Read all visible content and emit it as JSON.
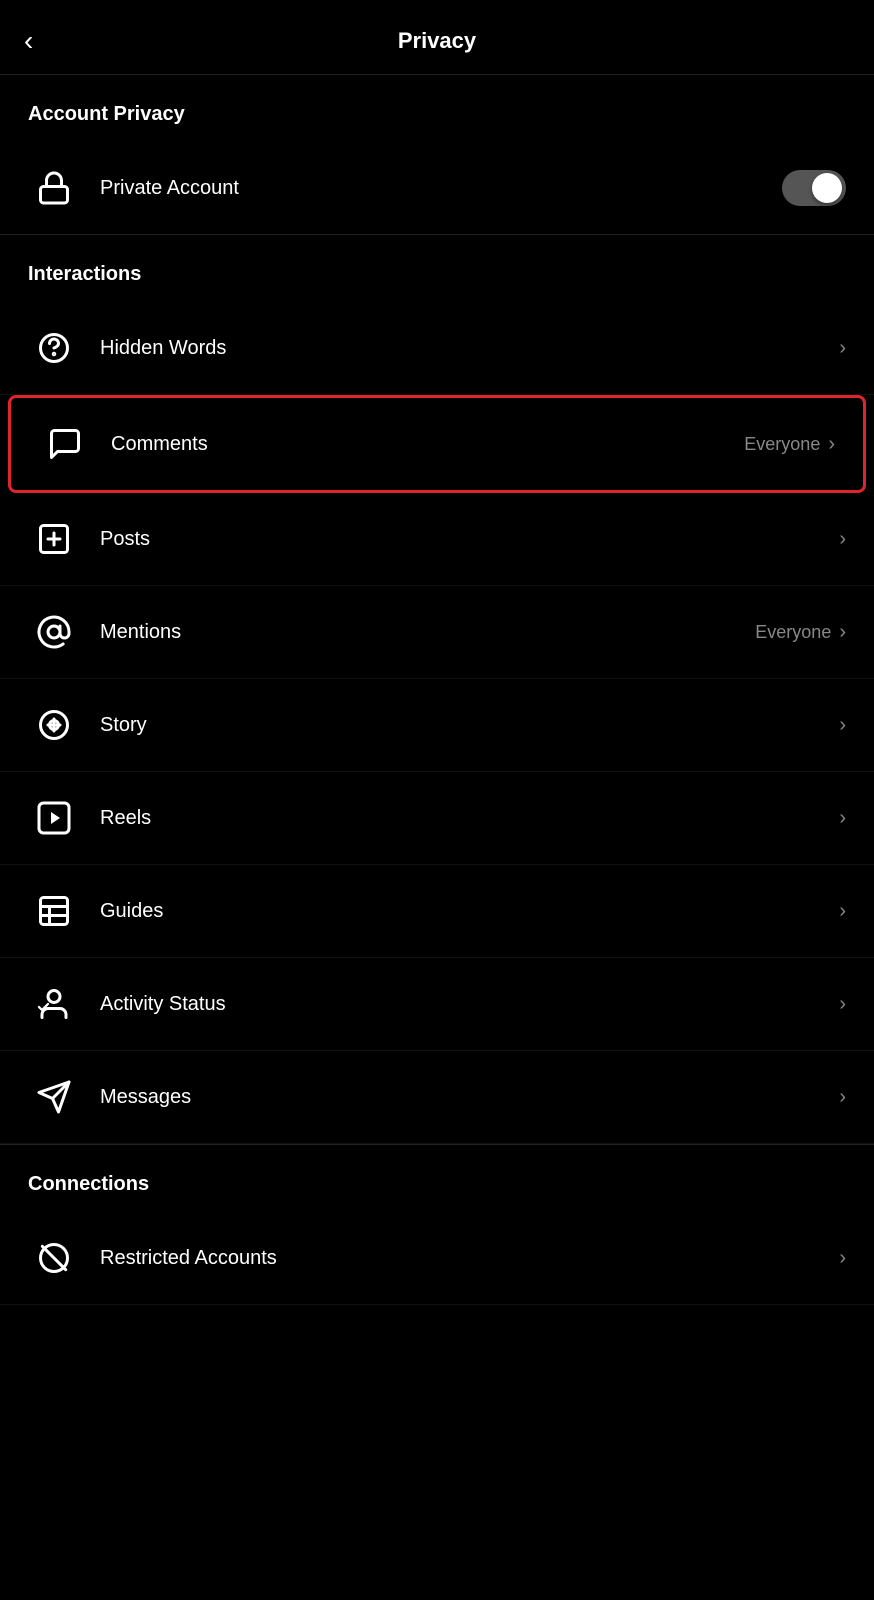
{
  "header": {
    "back_label": "‹",
    "title": "Privacy"
  },
  "account_privacy": {
    "section_label": "Account Privacy",
    "private_account": {
      "label": "Private Account",
      "toggle_on": true
    }
  },
  "interactions": {
    "section_label": "Interactions",
    "items": [
      {
        "id": "hidden-words",
        "label": "Hidden Words",
        "value": "",
        "icon": "hidden-words-icon",
        "highlighted": false
      },
      {
        "id": "comments",
        "label": "Comments",
        "value": "Everyone",
        "icon": "comments-icon",
        "highlighted": true
      },
      {
        "id": "posts",
        "label": "Posts",
        "value": "",
        "icon": "posts-icon",
        "highlighted": false
      },
      {
        "id": "mentions",
        "label": "Mentions",
        "value": "Everyone",
        "icon": "mentions-icon",
        "highlighted": false
      },
      {
        "id": "story",
        "label": "Story",
        "value": "",
        "icon": "story-icon",
        "highlighted": false
      },
      {
        "id": "reels",
        "label": "Reels",
        "value": "",
        "icon": "reels-icon",
        "highlighted": false
      },
      {
        "id": "guides",
        "label": "Guides",
        "value": "",
        "icon": "guides-icon",
        "highlighted": false
      },
      {
        "id": "activity-status",
        "label": "Activity Status",
        "value": "",
        "icon": "activity-status-icon",
        "highlighted": false
      },
      {
        "id": "messages",
        "label": "Messages",
        "value": "",
        "icon": "messages-icon",
        "highlighted": false
      }
    ]
  },
  "connections": {
    "section_label": "Connections",
    "items": [
      {
        "id": "restricted-accounts",
        "label": "Restricted Accounts",
        "value": "",
        "icon": "restricted-accounts-icon",
        "highlighted": false
      }
    ]
  }
}
